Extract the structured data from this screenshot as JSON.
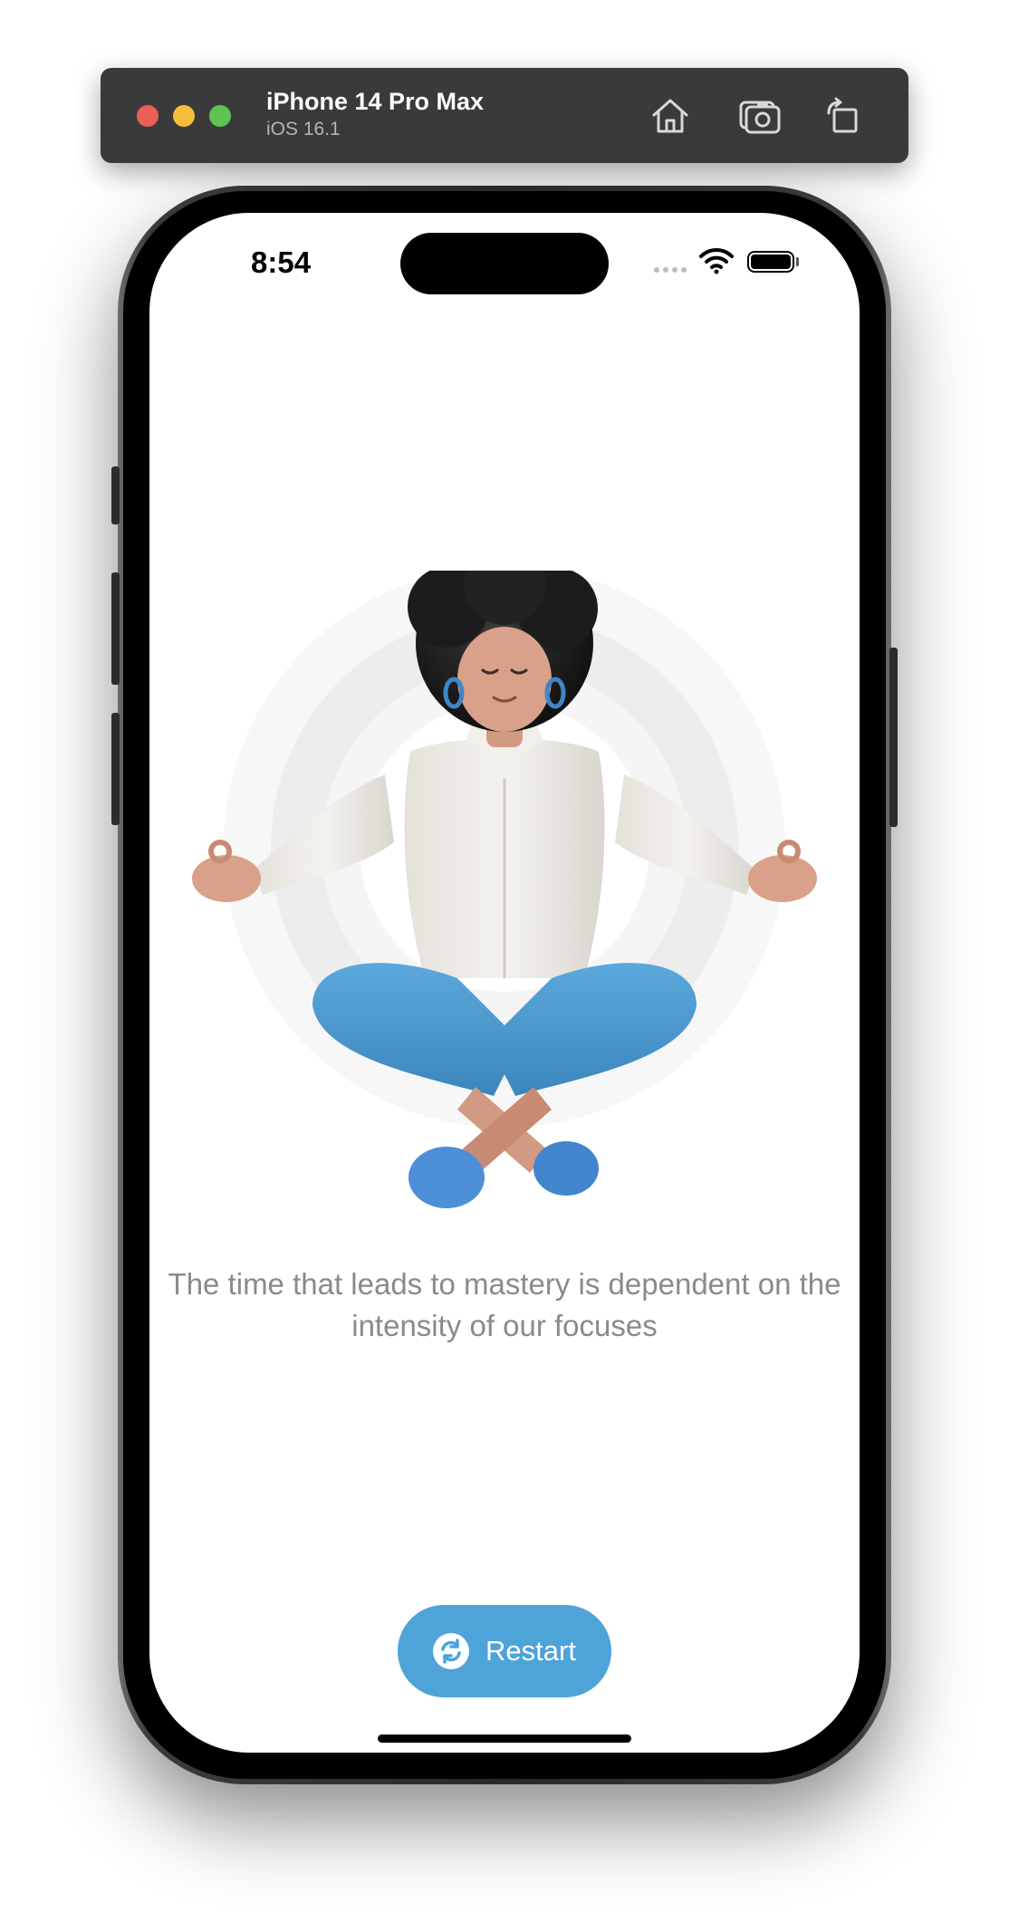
{
  "simulator": {
    "device_name": "iPhone 14 Pro Max",
    "os_version": "iOS 16.1",
    "toolbar_icons": [
      "home-icon",
      "screenshot-icon",
      "rotate-icon"
    ]
  },
  "status_bar": {
    "time": "8:54"
  },
  "main": {
    "illustration": "meditating-person-illustration",
    "quote": "The time that leads to mastery is dependent on the intensity of our focuses"
  },
  "restart_button": {
    "label": "Restart",
    "icon": "refresh-icon",
    "color": "#4ea3d9"
  }
}
